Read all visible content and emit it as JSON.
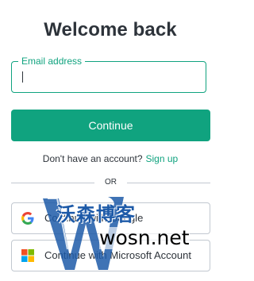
{
  "page": {
    "title": "Welcome back"
  },
  "email_field": {
    "label": "Email address",
    "value": "",
    "placeholder": ""
  },
  "continue_button": {
    "label": "Continue"
  },
  "signup": {
    "prompt": "Don't have an account?",
    "link": "Sign up"
  },
  "divider": {
    "text": "OR"
  },
  "social": {
    "google_label": "Continue with Google",
    "microsoft_label": "Continue with Microsoft Account",
    "google_icon": "google-g-icon",
    "microsoft_icon": "microsoft-logo-icon"
  },
  "watermark": {
    "brand": "沃森博客",
    "url": "wosn.net"
  },
  "colors": {
    "accent": "#10a37f",
    "text": "#2d333a",
    "border": "#c2c8d0"
  }
}
